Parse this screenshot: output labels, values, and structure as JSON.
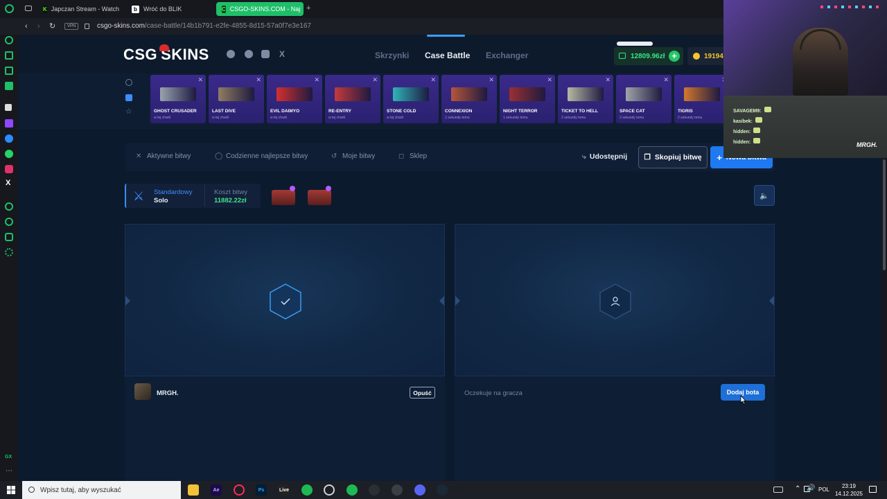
{
  "browser": {
    "tabs": [
      {
        "label": "Japczan Stream - Watch L",
        "favicon": "K",
        "color": "#53fc18"
      },
      {
        "label": "Wróć do BLIK",
        "favicon": "b",
        "color": "#ffffff"
      },
      {
        "label": "CSGO-SKINS.COM - Naj",
        "favicon": "C",
        "color": "#1fbf6a",
        "active": true
      }
    ],
    "vpn_label": "VPN",
    "url_host": "csgo-skins.com",
    "url_path": "/case-battle/14b1b791-e2fe-4855-8d15-57a0f7e3e167"
  },
  "site": {
    "logo": "CSG SKINS",
    "nav": [
      "Skrzynki",
      "Case Battle",
      "Exchanger"
    ],
    "nav_active_index": 1,
    "balance": "12809.96zł",
    "coins": "19194",
    "accent": "#3aa0ff"
  },
  "drops": [
    {
      "name": "GHOST CRUSADER",
      "time": "w tej chwili",
      "gun_color": "#9aa3b0"
    },
    {
      "name": "LAST DIVE",
      "time": "w tej chwili",
      "gun_color": "#8f7d62"
    },
    {
      "name": "EVIL DAIMYO",
      "time": "w tej chwili",
      "gun_color": "#d23030"
    },
    {
      "name": "RE-ENTRY",
      "time": "w tej chwili",
      "gun_color": "#c43a3a"
    },
    {
      "name": "STONE COLD",
      "time": "w tej chwili",
      "gun_color": "#2fb4b8"
    },
    {
      "name": "CONNEXION",
      "time": "1 sekundę temu",
      "gun_color": "#b4563a"
    },
    {
      "name": "NIGHT TERROR",
      "time": "1 sekundę temu",
      "gun_color": "#9a3030"
    },
    {
      "name": "TICKET TO HELL",
      "time": "2 sekundy temu",
      "gun_color": "#b8b8a4"
    },
    {
      "name": "SPACE CAT",
      "time": "2 sekundy temu",
      "gun_color": "#a0a4a8"
    },
    {
      "name": "TIGRIS",
      "time": "2 sekundy temu",
      "gun_color": "#d1782f"
    }
  ],
  "toolbar": {
    "active_battles": "Aktywne bitwy",
    "daily_best": "Codzienne najlepsze bitwy",
    "my_battles": "Moje bitwy",
    "shop": "Sklep",
    "share": "Udostępnij",
    "copy": "Skopiuj bitwę",
    "new": "Nowa bitwa"
  },
  "mode": {
    "type": "Standardowy",
    "players": "Solo",
    "cost_label": "Koszt bitwy",
    "cost_value": "11882.22zł"
  },
  "slots": [
    {
      "player": "MRGH.",
      "leave": "Opuść",
      "status_icon": "checkmark-icon"
    },
    {
      "waiting": "Oczekuje na gracza",
      "add_bot": "Dodaj bota",
      "status_icon": "user-icon"
    }
  ],
  "webcam": {
    "chat": [
      {
        "user": "SAVAGEM9:"
      },
      {
        "user": "kasibek:"
      },
      {
        "user": "hidden:"
      },
      {
        "user": "hidden:"
      }
    ],
    "watermark": "MRGH."
  },
  "taskbar": {
    "search_placeholder": "Wpisz tutaj, aby wyszukać",
    "lang": "POL",
    "time": "23:19",
    "date": "14.12.2025",
    "apps": [
      "files",
      "after-effects",
      "opera-gx",
      "photoshop",
      "live",
      "spotify",
      "ccleaner",
      "spotify-2",
      "obs",
      "other",
      "discord",
      "steam"
    ]
  }
}
